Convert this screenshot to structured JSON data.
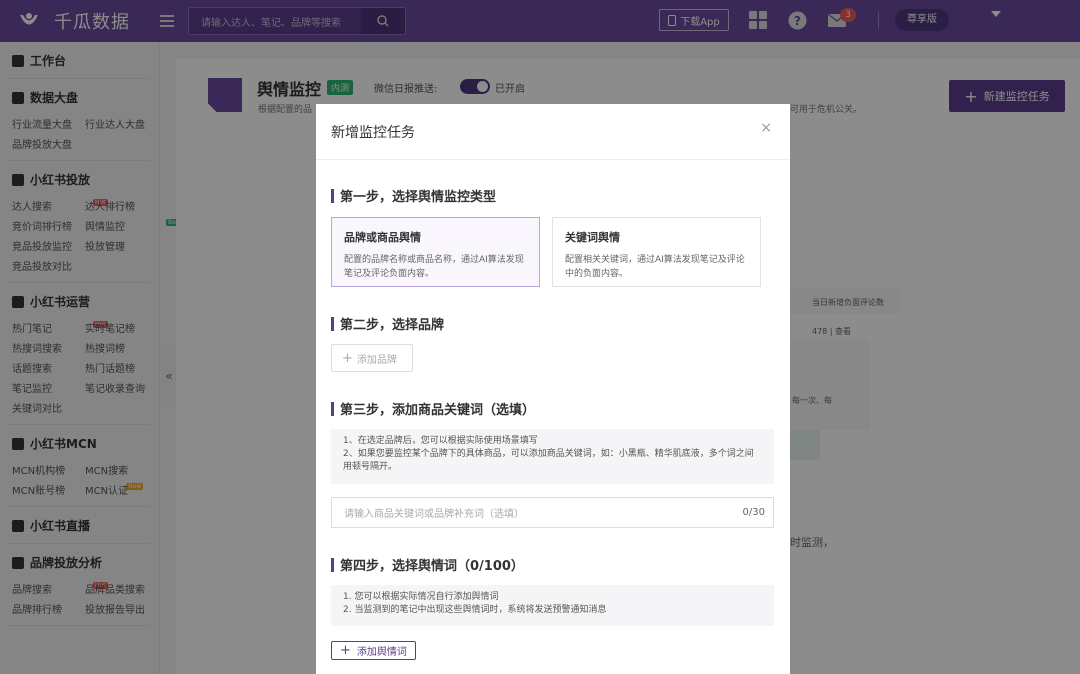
{
  "header": {
    "brand": "千瓜数据",
    "search_placeholder": "请输入达人、笔记、品牌等搜索",
    "download_app": "下载App",
    "notification_count": "3",
    "plan": "尊享版"
  },
  "sidebar": {
    "workbench": "工作台",
    "sections": [
      {
        "title": "数据大盘",
        "items": [
          {
            "label": "行业流量大盘"
          },
          {
            "label": "行业达人大盘"
          },
          {
            "label": "品牌投放大盘"
          }
        ]
      },
      {
        "title": "小红书投放",
        "items": [
          {
            "label": "达人搜索",
            "tag": "Hot"
          },
          {
            "label": "达人排行榜",
            "tag": "Hot"
          },
          {
            "label": "竞价词排行榜"
          },
          {
            "label": "舆情监控",
            "tag": "Beta"
          },
          {
            "label": "竞品投放监控"
          },
          {
            "label": "投放管理"
          },
          {
            "label": "竞品投放对比"
          }
        ]
      },
      {
        "title": "小红书运营",
        "items": [
          {
            "label": "热门笔记",
            "tag": "Hot"
          },
          {
            "label": "实时笔记榜"
          },
          {
            "label": "热搜词搜索"
          },
          {
            "label": "热搜词榜"
          },
          {
            "label": "话题搜索"
          },
          {
            "label": "热门话题榜"
          },
          {
            "label": "笔记监控"
          },
          {
            "label": "笔记收录查询"
          },
          {
            "label": "关键词对比"
          }
        ]
      },
      {
        "title": "小红书MCN",
        "items": [
          {
            "label": "MCN机构榜"
          },
          {
            "label": "MCN搜索"
          },
          {
            "label": "MCN账号榜",
            "tag": "New"
          },
          {
            "label": "MCN认证"
          }
        ]
      },
      {
        "title": "小红书直播",
        "items": []
      },
      {
        "title": "品牌投放分析",
        "items": [
          {
            "label": "品牌搜索",
            "tag": "Hot"
          },
          {
            "label": "品牌品类搜索",
            "tag": "New"
          },
          {
            "label": "品牌排行榜"
          },
          {
            "label": "投放报告导出"
          }
        ]
      }
    ],
    "collapse": "«"
  },
  "page": {
    "title": "舆情监控",
    "title_tag": "内测",
    "wechat_label": "微信日报推送:",
    "toggle_state": "已开启",
    "desc_left": "根据配置的品",
    "desc_right": "可用于危机公关。",
    "new_task": "新建监控任务",
    "bg_texts": [
      "当日新增负面评论数",
      "478 | 查看",
      "每一次、每",
      "时监测，"
    ]
  },
  "modal": {
    "title": "新增监控任务",
    "close": "×",
    "step1": "第一步，选择舆情监控类型",
    "options": [
      {
        "title": "品牌或商品舆情",
        "desc": "配置的品牌名称或商品名称，通过AI算法发现笔记及评论负面内容。",
        "selected": true
      },
      {
        "title": "关键词舆情",
        "desc": "配置相关关键词，通过AI算法发现笔记及评论中的负面内容。",
        "selected": false
      }
    ],
    "step2": "第二步，选择品牌",
    "add_brand": "添加品牌",
    "step3": "第三步，添加商品关键词（选填）",
    "step3_tips": [
      "1、在选定品牌后，您可以根据实际使用场景填写",
      "2、如果您要监控某个品牌下的具体商品，可以添加商品关键词，如：小黑瓶、精华肌底液，多个词之间用顿号隔开。"
    ],
    "keyword_placeholder": "请输入商品关键词或品牌补充词（选填）",
    "keyword_count": "0/30",
    "step4": "第四步，选择舆情词（0/100）",
    "step4_tips": [
      "1. 您可以根据实际情况自行添加舆情词",
      "2. 当监测到的笔记中出现这些舆情词时，系统将发送预警通知消息"
    ],
    "add_word": "添加舆情词"
  },
  "colors": {
    "brand": "#6b4a9e",
    "accent": "#5a3d8a",
    "hot": "#f05a5a",
    "beta": "#2bb673",
    "new": "#f5a623"
  }
}
